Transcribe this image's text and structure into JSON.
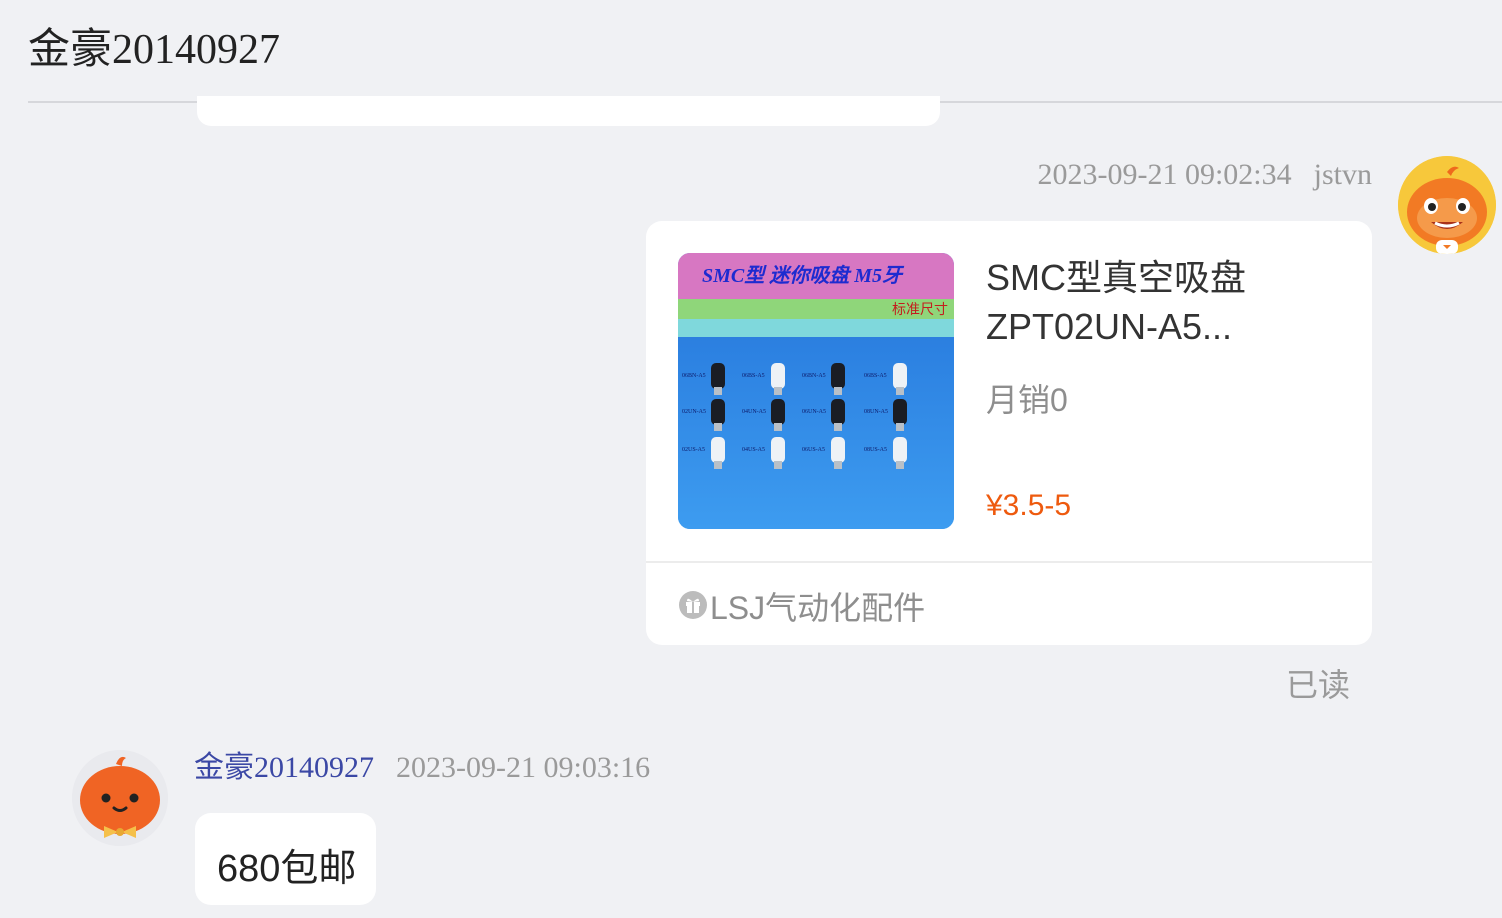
{
  "header": {
    "title": "金豪20140927"
  },
  "messages": {
    "outgoing": {
      "timestamp": "2023-09-21 09:02:34",
      "sender": "jstvn",
      "avatar_icon": "smiling-orange-mascot-avatar",
      "product_card": {
        "image_text": {
          "banner": "SMC型 迷你吸盘 M5牙",
          "subbanner": "标准尺寸",
          "part_labels": [
            "06BN-A5",
            "06BS-A5",
            "06BN-A5",
            "06BS-A5",
            "02UN-A5",
            "04UN-A5",
            "06UN-A5",
            "08UN-A5",
            "02US-A5",
            "04US-A5",
            "06US-A5",
            "08US-A5"
          ]
        },
        "title_line1": "SMC型真空吸盘",
        "title_line2": "ZPT02UN-A5...",
        "sales": "月销0",
        "price": "¥3.5-5",
        "shop_icon": "gift-icon",
        "shop_name": "LSJ气动化配件"
      },
      "read_status": "已读"
    },
    "incoming": {
      "sender": "金豪20140927",
      "timestamp": "2023-09-21 09:03:16",
      "avatar_icon": "orange-mascot-bowtie-avatar",
      "text": "680包邮"
    }
  },
  "colors": {
    "background": "#f0f1f4",
    "price": "#ee5a0e",
    "incoming_name": "#3b48a5",
    "meta_gray": "#9a9a9a"
  }
}
